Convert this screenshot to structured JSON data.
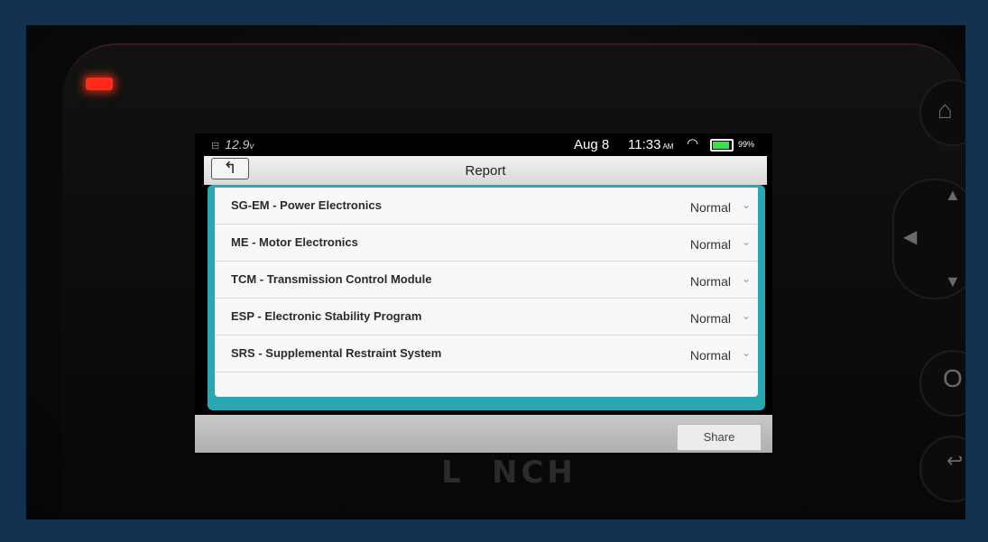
{
  "status_bar": {
    "voltage": "12.9",
    "voltage_unit": "v",
    "date": "Aug 8",
    "time": "11:33",
    "ampm": "AM",
    "battery_percent": "99%"
  },
  "header": {
    "title": "Report",
    "back_icon": "back-arrow-icon"
  },
  "report_items": [
    {
      "label": "SG-EM - Power Electronics",
      "status": "Normal"
    },
    {
      "label": "ME - Motor Electronics",
      "status": "Normal"
    },
    {
      "label": "TCM - Transmission Control Module",
      "status": "Normal"
    },
    {
      "label": "ESP - Electronic Stability Program",
      "status": "Normal"
    },
    {
      "label": "SRS - Supplemental Restraint System",
      "status": "Normal"
    }
  ],
  "footer": {
    "share_label": "Share"
  },
  "device": {
    "brand_text": "LAUNCH"
  },
  "colors": {
    "accent": "#2aa8b2",
    "led": "#ff2a1a",
    "frame": "#14304f"
  }
}
